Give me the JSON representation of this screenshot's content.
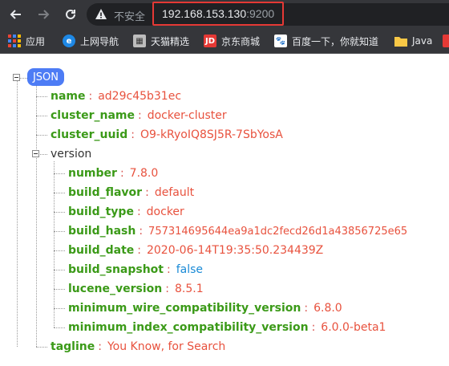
{
  "browser": {
    "security_label": "不安全",
    "url_host": "192.168.153.130",
    "url_port": ":9200",
    "highlight_color": "#e53935"
  },
  "bookmarks": [
    {
      "label": "应用",
      "icon": "apps-grid-icon"
    },
    {
      "label": "上网导航",
      "icon": "nav-e-icon"
    },
    {
      "label": "天猫精选",
      "icon": "tmall-icon"
    },
    {
      "label": "京东商城",
      "icon": "jd-icon"
    },
    {
      "label": "百度一下，你就知道",
      "icon": "baidu-paw-icon"
    },
    {
      "label": "Java",
      "icon": "folder-icon"
    }
  ],
  "json": {
    "root_label": "JSON",
    "fields": [
      {
        "key": "name",
        "value": "ad29c45b31ec"
      },
      {
        "key": "cluster_name",
        "value": "docker-cluster"
      },
      {
        "key": "cluster_uuid",
        "value": "O9-kRyoIQ8SJ5R-7SbYosA"
      }
    ],
    "version_key": "version",
    "version_fields": [
      {
        "key": "number",
        "value": "7.8.0"
      },
      {
        "key": "build_flavor",
        "value": "default"
      },
      {
        "key": "build_type",
        "value": "docker"
      },
      {
        "key": "build_hash",
        "value": "757314695644ea9a1dc2fecd26d1a43856725e65"
      },
      {
        "key": "build_date",
        "value": "2020-06-14T19:35:50.234439Z"
      },
      {
        "key": "build_snapshot",
        "value": "false"
      },
      {
        "key": "lucene_version",
        "value": "8.5.1"
      },
      {
        "key": "minimum_wire_compatibility_version",
        "value": "6.8.0"
      },
      {
        "key": "minimum_index_compatibility_version",
        "value": "6.0.0-beta1"
      }
    ],
    "tagline_key": "tagline",
    "tagline_value": "You Know, for Search",
    "colors": {
      "key": "#3b9a18",
      "string": "#e8523e",
      "boolean": "#1a8ad6",
      "badge": "#4d7cf5"
    }
  }
}
